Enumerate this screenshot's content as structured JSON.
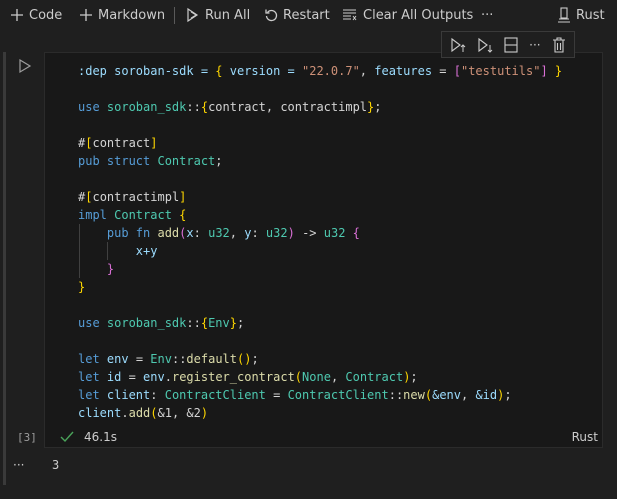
{
  "toolbar": {
    "add_code": "Code",
    "add_markdown": "Markdown",
    "run_all": "Run All",
    "restart": "Restart",
    "clear_outputs": "Clear All Outputs",
    "more": "···",
    "kernel": "Rust"
  },
  "cell": {
    "execution_count": "[3]",
    "status": "success",
    "duration": "46.1s",
    "language": "Rust",
    "code_lines": [
      [
        [
          ":dep soroban-sdk = ",
          "va"
        ],
        [
          "{",
          "b1"
        ],
        [
          " version = ",
          "va"
        ],
        [
          "\"22.0.7\"",
          "st"
        ],
        [
          ", ",
          "pl"
        ],
        [
          "features",
          "va"
        ],
        [
          " = ",
          "pl"
        ],
        [
          "[",
          "b2"
        ],
        [
          "\"testutils\"",
          "st"
        ],
        [
          "]",
          "b2"
        ],
        [
          " }",
          "b1"
        ]
      ],
      [],
      [
        [
          "use ",
          "kw"
        ],
        [
          "soroban_sdk",
          "ty"
        ],
        [
          "::",
          "pl"
        ],
        [
          "{",
          "b1"
        ],
        [
          "contract, contractimpl",
          "pl"
        ],
        [
          "}",
          "b1"
        ],
        [
          ";",
          "pl"
        ]
      ],
      [],
      [
        [
          "#",
          "pl"
        ],
        [
          "[",
          "b1"
        ],
        [
          "contract",
          "pl"
        ],
        [
          "]",
          "b1"
        ]
      ],
      [
        [
          "pub struct ",
          "kw"
        ],
        [
          "Contract",
          "ty"
        ],
        [
          ";",
          "pl"
        ]
      ],
      [],
      [
        [
          "#",
          "pl"
        ],
        [
          "[",
          "b1"
        ],
        [
          "contractimpl",
          "pl"
        ],
        [
          "]",
          "b1"
        ]
      ],
      [
        [
          "impl ",
          "kw"
        ],
        [
          "Contract ",
          "ty"
        ],
        [
          "{",
          "b1"
        ]
      ],
      [
        [
          "    pub fn ",
          "kw"
        ],
        [
          "add",
          "fn"
        ],
        [
          "(",
          "b2"
        ],
        [
          "x",
          "va"
        ],
        [
          ": ",
          "pl"
        ],
        [
          "u32",
          "ty"
        ],
        [
          ", ",
          "pl"
        ],
        [
          "y",
          "va"
        ],
        [
          ": ",
          "pl"
        ],
        [
          "u32",
          "ty"
        ],
        [
          ")",
          "b2"
        ],
        [
          " -> ",
          "pl"
        ],
        [
          "u32 ",
          "ty"
        ],
        [
          "{",
          "b2"
        ]
      ],
      [
        [
          "        x+y",
          "va"
        ]
      ],
      [
        [
          "    }",
          "b2"
        ]
      ],
      [
        [
          "}",
          "b1"
        ]
      ],
      [],
      [
        [
          "use ",
          "kw"
        ],
        [
          "soroban_sdk",
          "ty"
        ],
        [
          "::",
          "pl"
        ],
        [
          "{",
          "b1"
        ],
        [
          "Env",
          "ty"
        ],
        [
          "}",
          "b1"
        ],
        [
          ";",
          "pl"
        ]
      ],
      [],
      [
        [
          "let ",
          "kw"
        ],
        [
          "env",
          "va"
        ],
        [
          " = ",
          "pl"
        ],
        [
          "Env",
          "ty"
        ],
        [
          "::",
          "pl"
        ],
        [
          "default",
          "fn"
        ],
        [
          "()",
          "b1"
        ],
        [
          ";",
          "pl"
        ]
      ],
      [
        [
          "let ",
          "kw"
        ],
        [
          "id",
          "va"
        ],
        [
          " = ",
          "pl"
        ],
        [
          "env",
          "va"
        ],
        [
          ".",
          "pl"
        ],
        [
          "register_contract",
          "fn"
        ],
        [
          "(",
          "b1"
        ],
        [
          "None",
          "ty"
        ],
        [
          ", ",
          "pl"
        ],
        [
          "Contract",
          "ty"
        ],
        [
          ")",
          "b1"
        ],
        [
          ";",
          "pl"
        ]
      ],
      [
        [
          "let ",
          "kw"
        ],
        [
          "client",
          "va"
        ],
        [
          ": ",
          "pl"
        ],
        [
          "ContractClient",
          "ty"
        ],
        [
          " = ",
          "pl"
        ],
        [
          "ContractClient",
          "ty"
        ],
        [
          "::",
          "pl"
        ],
        [
          "new",
          "fn"
        ],
        [
          "(",
          "b1"
        ],
        [
          "&env",
          "va"
        ],
        [
          ", ",
          "pl"
        ],
        [
          "&id",
          "va"
        ],
        [
          ")",
          "b1"
        ],
        [
          ";",
          "pl"
        ]
      ],
      [
        [
          "client",
          "va"
        ],
        [
          ".",
          "pl"
        ],
        [
          "add",
          "fn"
        ],
        [
          "(",
          "b1"
        ],
        [
          "&1, &2",
          "pl"
        ],
        [
          ")",
          "b1"
        ]
      ]
    ]
  },
  "output": {
    "menu": "···",
    "value": "3"
  },
  "colors": {
    "success": "#4aa35a",
    "background": "#1f1f1f",
    "editor": "#181818"
  }
}
